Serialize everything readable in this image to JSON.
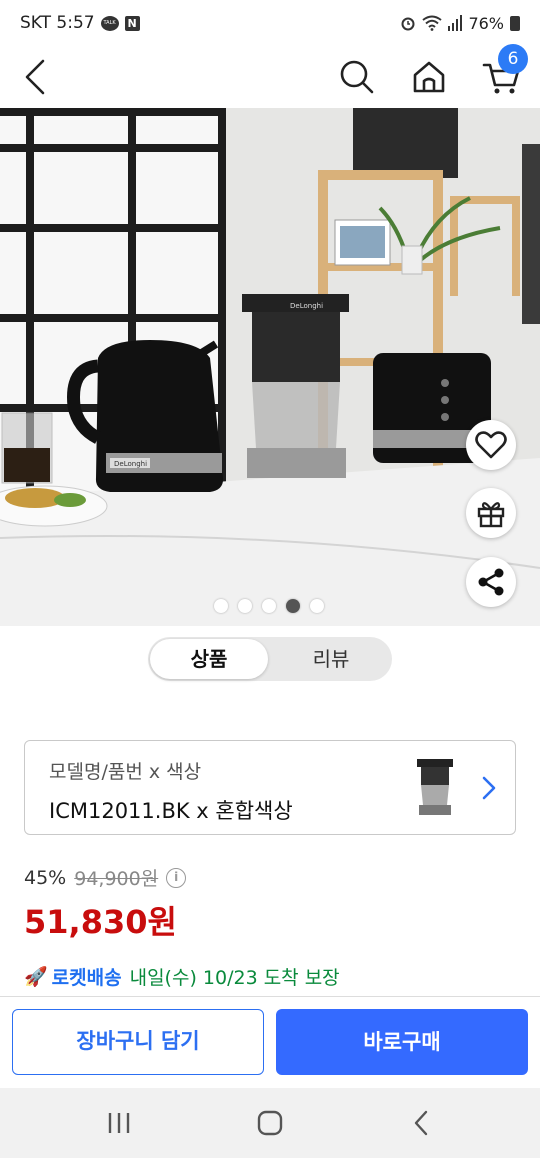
{
  "status_bar": {
    "carrier_time": "SKT 5:57",
    "battery": "76%",
    "talk_icon_text": "TALK",
    "n_icon_text": "N"
  },
  "nav": {
    "cart_count": "6"
  },
  "hero": {
    "image_count": 5,
    "active_index": 3,
    "brand_text": "DeLonghi"
  },
  "tabs": {
    "product": "상품",
    "review": "리뷰"
  },
  "option": {
    "label": "모델명/품번 x 색상",
    "value": "ICM12011.BK x 혼합색상"
  },
  "price": {
    "discount": "45%",
    "original": "94,900원",
    "sale": "51,830원",
    "info_icon_text": "i"
  },
  "delivery": {
    "icon": "🚀",
    "rocket_label": "로켓배송",
    "text": "내일(수) 10/23 도착 보장"
  },
  "actions": {
    "add_to_cart": "장바구니 담기",
    "buy_now": "바로구매"
  },
  "colors": {
    "accent": "#346aff",
    "price_red": "#c80d0d",
    "delivery_green": "#0a8a3c",
    "badge_blue": "#2c7bf6"
  }
}
